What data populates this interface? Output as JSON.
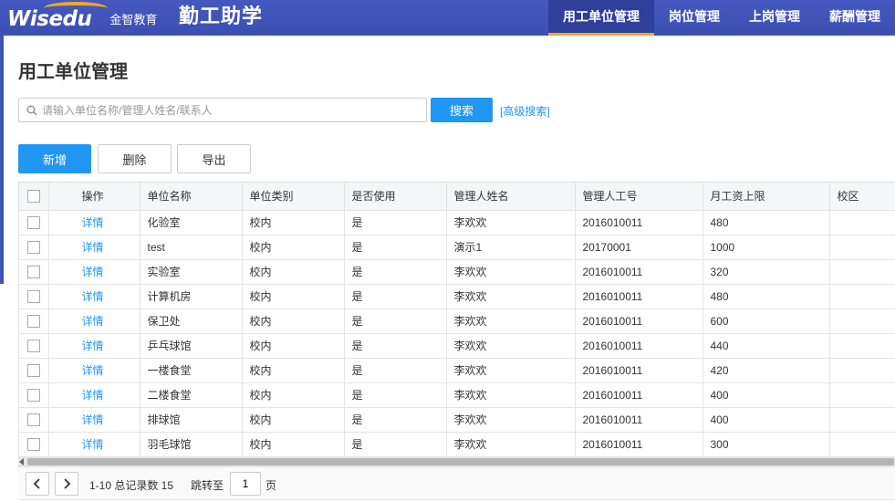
{
  "header": {
    "logo_text": "Wisedu",
    "logo_cn": "金智教育",
    "app_title": "勤工助学",
    "nav": [
      {
        "label": "用工单位管理",
        "active": true
      },
      {
        "label": "岗位管理",
        "active": false
      },
      {
        "label": "上岗管理",
        "active": false
      },
      {
        "label": "薪酬管理",
        "active": false
      }
    ]
  },
  "page": {
    "title": "用工单位管理"
  },
  "search": {
    "placeholder": "请输入单位名称/管理人姓名/联系人",
    "value": "",
    "button_label": "搜索",
    "advanced_label": "[高级搜索]"
  },
  "toolbar": {
    "add_label": "新增",
    "delete_label": "删除",
    "export_label": "导出"
  },
  "table": {
    "columns": [
      "操作",
      "单位名称",
      "单位类别",
      "是否使用",
      "管理人姓名",
      "管理人工号",
      "月工资上限",
      "校区"
    ],
    "rows": [
      {
        "op": "详情",
        "name": "化验室",
        "type": "校内",
        "inuse": "是",
        "mgr": "李欢欢",
        "no": "2016010011",
        "wage": "480",
        "campus": ""
      },
      {
        "op": "详情",
        "name": "test",
        "type": "校内",
        "inuse": "是",
        "mgr": "演示1",
        "no": "20170001",
        "wage": "1000",
        "campus": ""
      },
      {
        "op": "详情",
        "name": "实验室",
        "type": "校内",
        "inuse": "是",
        "mgr": "李欢欢",
        "no": "2016010011",
        "wage": "320",
        "campus": ""
      },
      {
        "op": "详情",
        "name": "计算机房",
        "type": "校内",
        "inuse": "是",
        "mgr": "李欢欢",
        "no": "2016010011",
        "wage": "480",
        "campus": ""
      },
      {
        "op": "详情",
        "name": "保卫处",
        "type": "校内",
        "inuse": "是",
        "mgr": "李欢欢",
        "no": "2016010011",
        "wage": "600",
        "campus": ""
      },
      {
        "op": "详情",
        "name": "乒乓球馆",
        "type": "校内",
        "inuse": "是",
        "mgr": "李欢欢",
        "no": "2016010011",
        "wage": "440",
        "campus": ""
      },
      {
        "op": "详情",
        "name": "一楼食堂",
        "type": "校内",
        "inuse": "是",
        "mgr": "李欢欢",
        "no": "2016010011",
        "wage": "420",
        "campus": ""
      },
      {
        "op": "详情",
        "name": "二楼食堂",
        "type": "校内",
        "inuse": "是",
        "mgr": "李欢欢",
        "no": "2016010011",
        "wage": "400",
        "campus": ""
      },
      {
        "op": "详情",
        "name": "排球馆",
        "type": "校内",
        "inuse": "是",
        "mgr": "李欢欢",
        "no": "2016010011",
        "wage": "400",
        "campus": ""
      },
      {
        "op": "详情",
        "name": "羽毛球馆",
        "type": "校内",
        "inuse": "是",
        "mgr": "李欢欢",
        "no": "2016010011",
        "wage": "300",
        "campus": ""
      }
    ]
  },
  "pager": {
    "info": "1-10 总记录数 15",
    "jump_label": "跳转至",
    "page_value": "1",
    "page_unit": "页"
  },
  "colors": {
    "header_bg": "#3f51b5",
    "accent": "#2196f3",
    "nav_active_underline": "#f5a623"
  }
}
